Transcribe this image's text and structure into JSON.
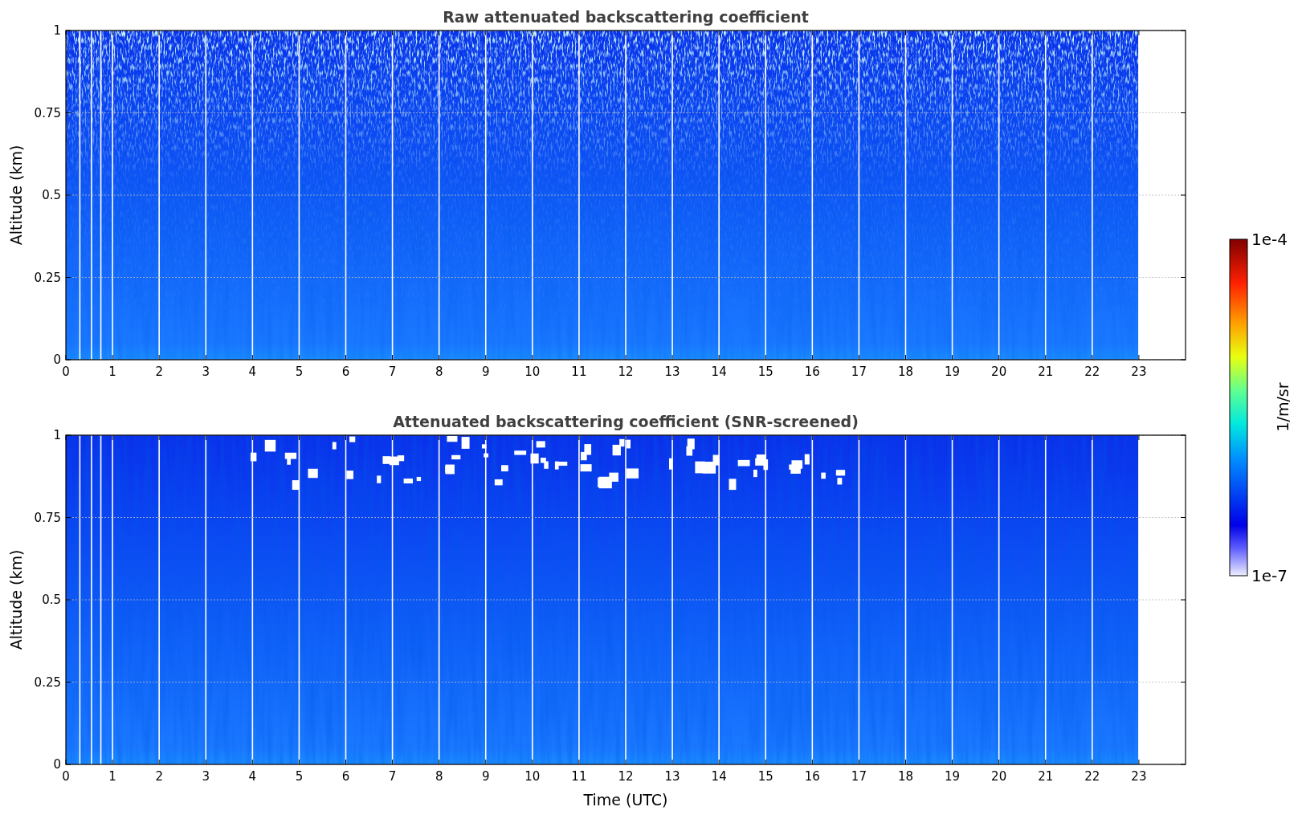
{
  "panels": [
    {
      "title": "Raw attenuated backscattering coefficient",
      "ylabel": "Altitude (km)",
      "screened": false,
      "yticks": [
        "1",
        "0.75",
        "0.5",
        "0.25",
        "0"
      ],
      "xticks": [
        "0",
        "1",
        "2",
        "3",
        "4",
        "5",
        "6",
        "7",
        "8",
        "9",
        "10",
        "11",
        "12",
        "13",
        "14",
        "15",
        "16",
        "17",
        "18",
        "19",
        "20",
        "21",
        "22",
        "23"
      ]
    },
    {
      "title": "Attenuated backscattering coefficient (SNR-screened)",
      "ylabel": "Altitude (km)",
      "screened": true,
      "yticks": [
        "1",
        "0.75",
        "0.5",
        "0.25",
        "0"
      ],
      "xticks": [
        "0",
        "1",
        "2",
        "3",
        "4",
        "5",
        "6",
        "7",
        "8",
        "9",
        "10",
        "11",
        "12",
        "13",
        "14",
        "15",
        "16",
        "17",
        "18",
        "19",
        "20",
        "21",
        "22",
        "23"
      ]
    }
  ],
  "xlabel": "Time (UTC)",
  "colorbar": {
    "max_label": "1e-4",
    "min_label": "1e-7",
    "label": "1/m/sr"
  }
}
